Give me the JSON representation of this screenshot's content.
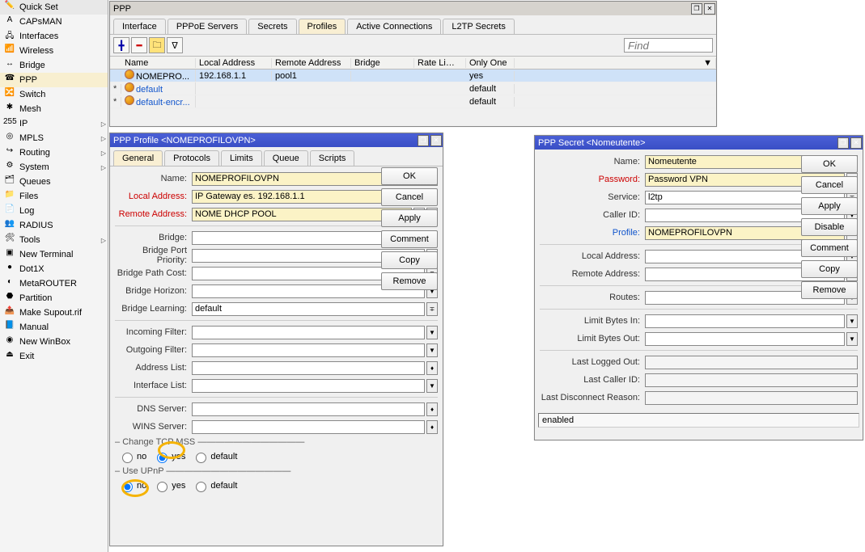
{
  "sidebar": {
    "items": [
      {
        "label": "Quick Set",
        "icon": "✏️"
      },
      {
        "label": "CAPsMAN",
        "icon": "A"
      },
      {
        "label": "Interfaces",
        "icon": "🖧"
      },
      {
        "label": "Wireless",
        "icon": "📶"
      },
      {
        "label": "Bridge",
        "icon": "↔"
      },
      {
        "label": "PPP",
        "icon": "☎"
      },
      {
        "label": "Switch",
        "icon": "🔀"
      },
      {
        "label": "Mesh",
        "icon": "✱"
      },
      {
        "label": "IP",
        "icon": "255",
        "expand": true
      },
      {
        "label": "MPLS",
        "icon": "◎",
        "expand": true
      },
      {
        "label": "Routing",
        "icon": "↪",
        "expand": true
      },
      {
        "label": "System",
        "icon": "⚙",
        "expand": true
      },
      {
        "label": "Queues",
        "icon": "🗂"
      },
      {
        "label": "Files",
        "icon": "📁"
      },
      {
        "label": "Log",
        "icon": "📄"
      },
      {
        "label": "RADIUS",
        "icon": "👥"
      },
      {
        "label": "Tools",
        "icon": "🛠",
        "expand": true
      },
      {
        "label": "New Terminal",
        "icon": "▣"
      },
      {
        "label": "Dot1X",
        "icon": "●"
      },
      {
        "label": "MetaROUTER",
        "icon": "◐"
      },
      {
        "label": "Partition",
        "icon": "⬣"
      },
      {
        "label": "Make Supout.rif",
        "icon": "📤"
      },
      {
        "label": "Manual",
        "icon": "📘"
      },
      {
        "label": "New WinBox",
        "icon": "◉"
      },
      {
        "label": "Exit",
        "icon": "⏏"
      }
    ],
    "selected_index": 5
  },
  "ppp_window": {
    "title": "PPP",
    "tabs": [
      "Interface",
      "PPPoE Servers",
      "Secrets",
      "Profiles",
      "Active Connections",
      "L2TP Secrets"
    ],
    "selected_tab": 3,
    "find_placeholder": "Find",
    "columns": [
      "Name",
      "Local Address",
      "Remote Address",
      "Bridge",
      "Rate Limit...",
      "Only One"
    ],
    "rows": [
      {
        "star": "",
        "name": "NOMEPRO...",
        "local": "192.168.1.1",
        "remote": "pool1",
        "bridge": "",
        "rate": "",
        "only": "yes",
        "selected": true
      },
      {
        "star": "*",
        "name": "default",
        "local": "",
        "remote": "",
        "bridge": "",
        "rate": "",
        "only": "default"
      },
      {
        "star": "*",
        "name": "default-encr...",
        "local": "",
        "remote": "",
        "bridge": "",
        "rate": "",
        "only": "default"
      }
    ]
  },
  "profile_dialog": {
    "title": "PPP Profile <NOMEPROFILOVPN>",
    "tabs": [
      "General",
      "Protocols",
      "Limits",
      "Queue",
      "Scripts"
    ],
    "selected_tab": 0,
    "fields": {
      "name_label": "Name:",
      "name_value": "NOMEPROFILOVPN",
      "local_label": "Local Address:",
      "local_value": "IP Gateway es. 192.168.1.1",
      "remote_label": "Remote Address:",
      "remote_value": "NOME DHCP POOL",
      "bridge_label": "Bridge:",
      "bridge_port_label": "Bridge Port Priority:",
      "bridge_path_label": "Bridge Path Cost:",
      "bridge_horizon_label": "Bridge Horizon:",
      "bridge_learning_label": "Bridge Learning:",
      "bridge_learning_value": "default",
      "incoming_label": "Incoming Filter:",
      "outgoing_label": "Outgoing Filter:",
      "address_list_label": "Address List:",
      "interface_list_label": "Interface List:",
      "dns_label": "DNS Server:",
      "wins_label": "WINS Server:",
      "tcp_mss_title": "Change TCP MSS",
      "upnp_title": "Use UPnP",
      "radio_no": "no",
      "radio_yes": "yes",
      "radio_default": "default"
    },
    "buttons": [
      "OK",
      "Cancel",
      "Apply",
      "Comment",
      "Copy",
      "Remove"
    ]
  },
  "secret_dialog": {
    "title": "PPP Secret <Nomeutente>",
    "fields": {
      "name_label": "Name:",
      "name_value": "Nomeutente",
      "password_label": "Password:",
      "password_value": "Password VPN",
      "service_label": "Service:",
      "service_value": "l2tp",
      "caller_label": "Caller ID:",
      "profile_label": "Profile:",
      "profile_value": "NOMEPROFILOVPN",
      "local_label": "Local Address:",
      "remote_label": "Remote Address:",
      "routes_label": "Routes:",
      "limit_in_label": "Limit Bytes In:",
      "limit_out_label": "Limit Bytes Out:",
      "last_logged_label": "Last Logged Out:",
      "last_caller_label": "Last Caller ID:",
      "last_disc_label": "Last Disconnect Reason:"
    },
    "status": "enabled",
    "buttons": [
      "OK",
      "Cancel",
      "Apply",
      "Disable",
      "Comment",
      "Copy",
      "Remove"
    ]
  }
}
